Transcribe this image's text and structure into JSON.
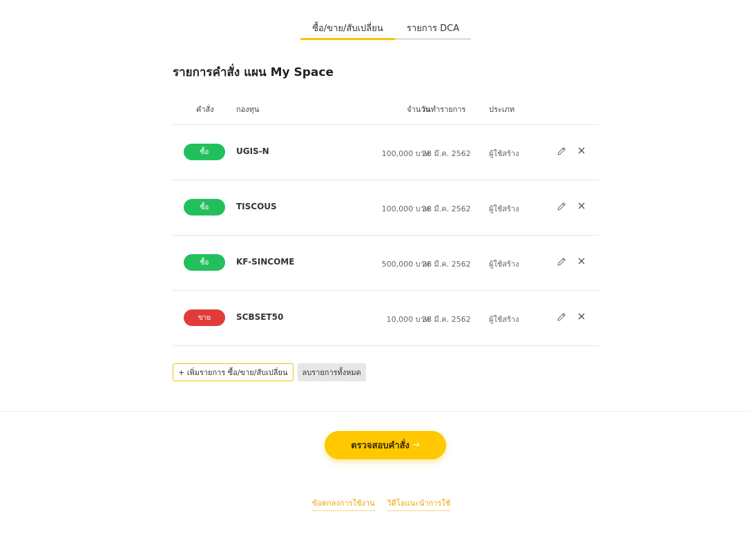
{
  "tabs": [
    {
      "label": "ซื้อ/ขาย/สับเปลี่ยน",
      "active": true
    },
    {
      "label": "รายการ DCA",
      "active": false
    }
  ],
  "section_title": "รายการคำสั่ง แผน My Space",
  "table": {
    "headers": {
      "order": "คำสั่ง",
      "fund": "กองทุน",
      "amount": "จำนวน",
      "date": "วันทำรายการ",
      "type": "ประเภท"
    },
    "rows": [
      {
        "order": "ซื้อ",
        "order_kind": "buy",
        "fund": "UGIS-N",
        "amount": "100,000 บาท",
        "date": "28 มี.ค. 2562",
        "type": "ผู้ใช้สร้าง"
      },
      {
        "order": "ซื้อ",
        "order_kind": "buy",
        "fund": "TISCOUS",
        "amount": "100,000 บาท",
        "date": "28 มี.ค. 2562",
        "type": "ผู้ใช้สร้าง"
      },
      {
        "order": "ซื้อ",
        "order_kind": "buy",
        "fund": "KF-SINCOME",
        "amount": "500,000 บาท",
        "date": "28 มี.ค. 2562",
        "type": "ผู้ใช้สร้าง"
      },
      {
        "order": "ขาย",
        "order_kind": "sell",
        "fund": "SCBSET50",
        "amount": "10,000 บาท",
        "date": "28 มี.ค. 2562",
        "type": "ผู้ใช้สร้าง"
      }
    ]
  },
  "actions": {
    "add_label": "+ เพิ่มรายการ ซื้อ/ขาย/สับเปลี่ยน",
    "clear_label": "ลบรายการทั้งหมด"
  },
  "review_button": {
    "label": "ตรวจสอบคำสั่ง",
    "arrow": "→"
  },
  "footer": {
    "terms": "ข้อตกลงการใช้งาน",
    "video": "วิดีโอแนะนำการใช้"
  },
  "colors": {
    "accent": "#ffc800",
    "buy": "#21c05c",
    "sell": "#e23b3b"
  },
  "icons": {
    "edit": "pencil-icon",
    "delete": "close-icon"
  }
}
